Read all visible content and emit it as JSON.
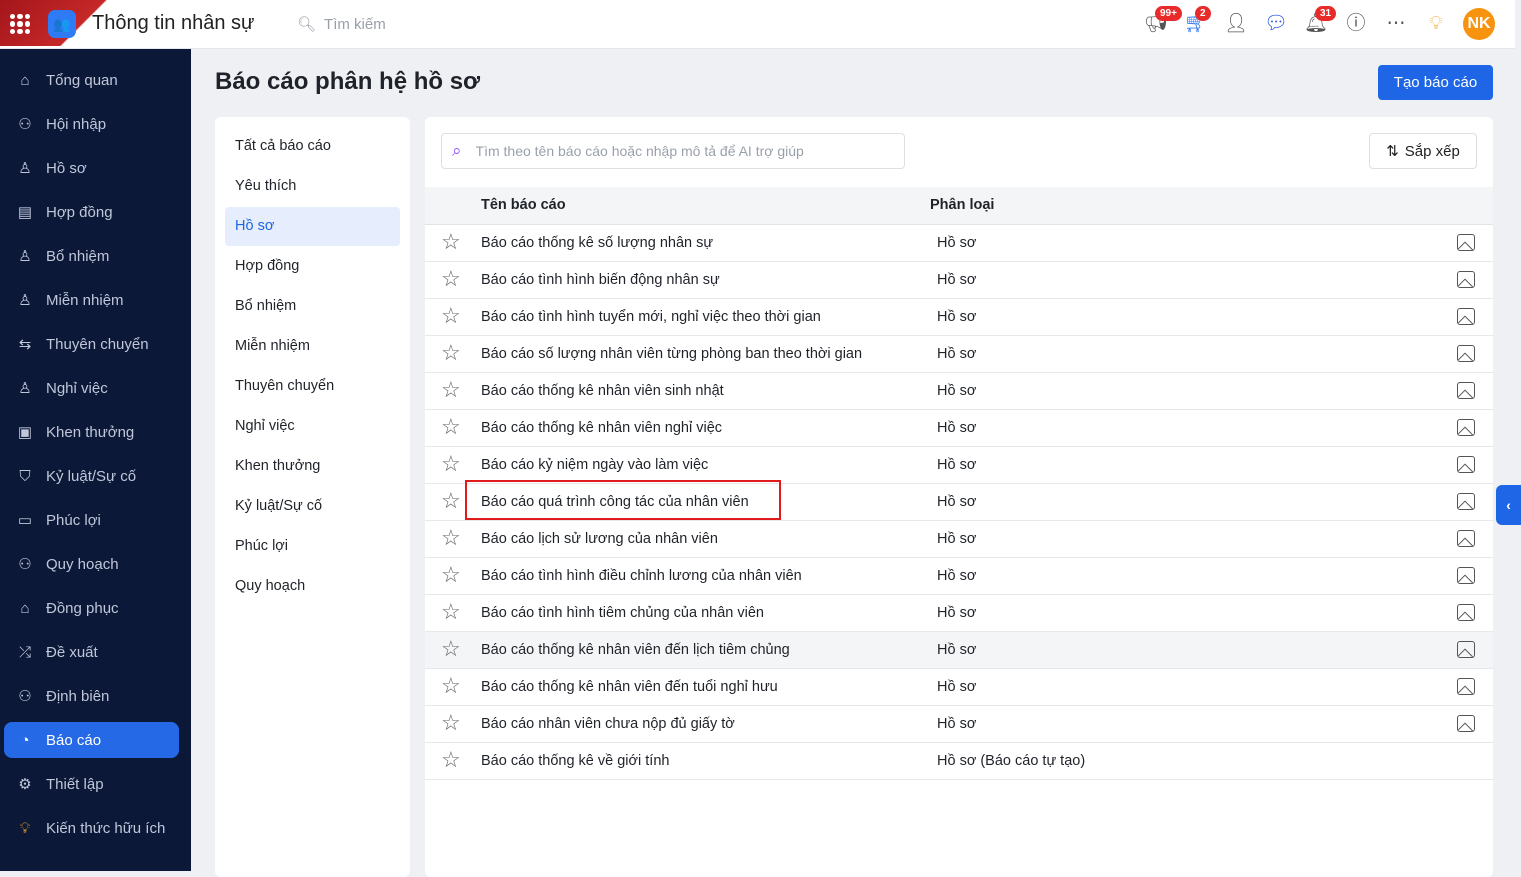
{
  "header": {
    "app_title": "Thông tin nhân sự",
    "search_placeholder": "Tìm kiếm",
    "badges": {
      "announcements": "99+",
      "cart": "2",
      "notifications": "31"
    },
    "avatar_initials": "NK"
  },
  "sidebar": {
    "items": [
      {
        "label": "Tổng quan",
        "icon": "home-icon"
      },
      {
        "label": "Hội nhập",
        "icon": "onboarding-icon"
      },
      {
        "label": "Hồ sơ",
        "icon": "profile-icon"
      },
      {
        "label": "Hợp đồng",
        "icon": "contract-icon"
      },
      {
        "label": "Bổ nhiệm",
        "icon": "appoint-icon"
      },
      {
        "label": "Miễn nhiệm",
        "icon": "dismiss-icon"
      },
      {
        "label": "Thuyên chuyển",
        "icon": "transfer-icon"
      },
      {
        "label": "Nghỉ việc",
        "icon": "resign-icon"
      },
      {
        "label": "Khen thưởng",
        "icon": "reward-icon"
      },
      {
        "label": "Kỷ luật/Sự cố",
        "icon": "shield-icon"
      },
      {
        "label": "Phúc lợi",
        "icon": "welfare-icon"
      },
      {
        "label": "Quy hoạch",
        "icon": "planning-icon"
      },
      {
        "label": "Đồng phục",
        "icon": "uniform-icon"
      },
      {
        "label": "Đề xuất",
        "icon": "proposal-icon"
      },
      {
        "label": "Định biên",
        "icon": "headcount-icon"
      },
      {
        "label": "Báo cáo",
        "icon": "pie-chart-icon"
      },
      {
        "label": "Thiết lập",
        "icon": "gear-icon"
      },
      {
        "label": "Kiến thức hữu ích",
        "icon": "lightbulb-book-icon"
      }
    ],
    "active": "Báo cáo"
  },
  "page": {
    "title": "Báo cáo phân hệ hồ sơ",
    "create_button": "Tạo báo cáo"
  },
  "categories": {
    "items": [
      "Tất cả báo cáo",
      "Yêu thích",
      "Hồ sơ",
      "Hợp đồng",
      "Bổ nhiệm",
      "Miễn nhiệm",
      "Thuyên chuyển",
      "Nghỉ việc",
      "Khen thưởng",
      "Kỷ luật/Sự cố",
      "Phúc lợi",
      "Quy hoạch"
    ],
    "active": "Hồ sơ"
  },
  "table": {
    "search_placeholder": "Tìm theo tên báo cáo hoặc nhập mô tả để AI trợ giúp",
    "sort_label": "Sắp xếp",
    "columns": [
      "Tên báo cáo",
      "Phân loại"
    ],
    "rows": [
      {
        "name": "Báo cáo thống kê số lượng nhân sự",
        "type": "Hồ sơ"
      },
      {
        "name": "Báo cáo tình hình biến động nhân sự",
        "type": "Hồ sơ"
      },
      {
        "name": "Báo cáo tình hình tuyển mới, nghỉ việc theo thời gian",
        "type": "Hồ sơ"
      },
      {
        "name": "Báo cáo số lượng nhân viên từng phòng ban theo thời gian",
        "type": "Hồ sơ"
      },
      {
        "name": "Báo cáo thống kê nhân viên sinh nhật",
        "type": "Hồ sơ"
      },
      {
        "name": "Báo cáo thống kê nhân viên nghỉ việc",
        "type": "Hồ sơ"
      },
      {
        "name": "Báo cáo kỷ niệm ngày vào làm việc",
        "type": "Hồ sơ"
      },
      {
        "name": "Báo cáo quá trình công tác của nhân viên",
        "type": "Hồ sơ"
      },
      {
        "name": "Báo cáo lịch sử lương của nhân viên",
        "type": "Hồ sơ"
      },
      {
        "name": "Báo cáo tình hình điều chỉnh lương của nhân viên",
        "type": "Hồ sơ"
      },
      {
        "name": "Báo cáo tình hình tiêm chủng của nhân viên",
        "type": "Hồ sơ"
      },
      {
        "name": "Báo cáo thống kê nhân viên đến lịch tiêm chủng",
        "type": "Hồ sơ"
      },
      {
        "name": "Báo cáo thống kê nhân viên đến tuổi nghỉ hưu",
        "type": "Hồ sơ"
      },
      {
        "name": "Báo cáo nhân viên chưa nộp đủ giấy tờ",
        "type": "Hồ sơ"
      },
      {
        "name": "Báo cáo thống kê về giới tính",
        "type": "Hồ sơ (Báo cáo tự tạo)"
      }
    ]
  }
}
